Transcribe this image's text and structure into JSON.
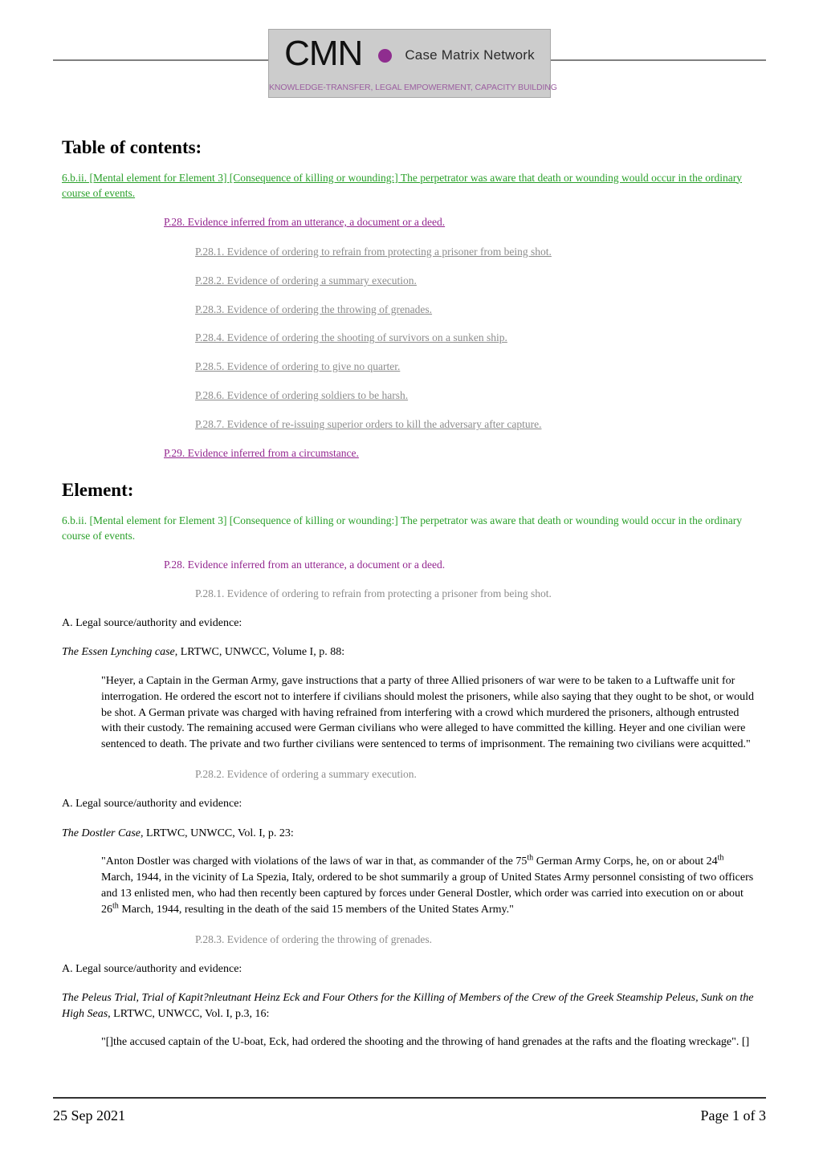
{
  "header": {
    "logo": {
      "acronym": "CMN",
      "name": "Case Matrix Network",
      "tagline": "KNOWLEDGE-TRANSFER, LEGAL EMPOWERMENT, CAPACITY BUILDING",
      "dot_color": "#8f2d8f",
      "tagline_color": "#9b5fa0",
      "background_color": "#cccccc"
    }
  },
  "colors": {
    "element_green": "#2aa02a",
    "p_purple": "#93268f",
    "subitem_gray": "#8c8c8c"
  },
  "toc": {
    "heading": "Table of contents:",
    "element_link": "6.b.ii. [Mental element for Element 3] [Consequence of killing or wounding:] The perpetrator was aware that death or wounding would occur in the ordinary course of events.",
    "p28_link": "P.28. Evidence inferred from an utterance, a document or a deed.",
    "subitems": [
      "P.28.1. Evidence of ordering to refrain from protecting a prisoner from being shot.",
      "P.28.2. Evidence of ordering a summary execution.",
      "P.28.3. Evidence of ordering the throwing of grenades.",
      "P.28.4. Evidence of ordering the shooting of survivors on a sunken ship.",
      "P.28.5. Evidence of ordering to give no quarter.",
      "P.28.6. Evidence of ordering soldiers to be harsh.",
      "P.28.7. Evidence of re-issuing superior orders to kill the adversary after capture."
    ],
    "p29_link": "P.29. Evidence inferred from a circumstance."
  },
  "element": {
    "heading": "Element:",
    "element_text": "6.b.ii. [Mental element for Element 3] [Consequence of killing or wounding:] The perpetrator was aware that death or wounding would occur in the ordinary course of events.",
    "p28_text": "P.28. Evidence inferred from an utterance, a document or a deed.",
    "entries": [
      {
        "subheading": "P.28.1. Evidence of ordering to refrain from protecting a prisoner from being shot.",
        "legal_source_label": "A. Legal source/authority and evidence:",
        "citation_italic": "The Essen Lynching case",
        "citation_rest": ", LRTWC, UNWCC, Volume I, p. 88:",
        "quote": "\"Heyer, a Captain in the German Army, gave instructions that a party of three Allied prisoners of war were to be taken to a Luftwaffe unit for interrogation. He ordered the escort not to interfere if civilians should molest the prisoners, while also saying that they ought to be shot, or would be shot. A German private was charged with having refrained from interfering with a crowd which murdered the prisoners, although entrusted with their custody. The remaining accused were German civilians who were alleged to have committed the killing. Heyer and one civilian were sentenced to death. The private and two further civilians were sentenced to terms of imprisonment. The remaining two civilians were acquitted.\""
      },
      {
        "subheading": "P.28.2. Evidence of ordering a summary execution.",
        "legal_source_label": "A. Legal source/authority and evidence:",
        "citation_italic": "The Dostler Case",
        "citation_rest": ", LRTWC, UNWCC, Vol. I, p. 23:",
        "quote_parts": {
          "a": "\"Anton Dostler was charged with violations of the laws of war in that, as commander of the 75",
          "sup1": "th",
          "b": " German Army Corps, he, on or about 24",
          "sup2": "th",
          "c": " March, 1944, in the vicinity of La Spezia, Italy, ordered to be shot summarily a group of United States Army personnel consisting of two officers and 13 enlisted men, who had then recently been captured by forces under General Dostler, which order was carried into execution on or about 26",
          "sup3": "th",
          "d": " March, 1944, resulting in the death of the said 15 members of the United States Army.\""
        }
      },
      {
        "subheading": "P.28.3. Evidence of ordering the throwing of grenades.",
        "legal_source_label": "A. Legal source/authority and evidence:",
        "citation_italic": "The Peleus Trial, Trial of Kapit?nleutnant Heinz Eck and Four Others for the Killing of Members of the Crew of the Greek Steamship Peleus, Sunk on the High Seas,",
        "citation_rest": " LRTWC, UNWCC, Vol. I, p.3, 16:",
        "quote": "\"[]the accused captain of the U-boat, Eck, had ordered the shooting and the throwing of hand grenades at the rafts and the floating wreckage\". []"
      }
    ]
  },
  "footer": {
    "date": "25 Sep 2021",
    "page": "Page 1 of 3"
  }
}
